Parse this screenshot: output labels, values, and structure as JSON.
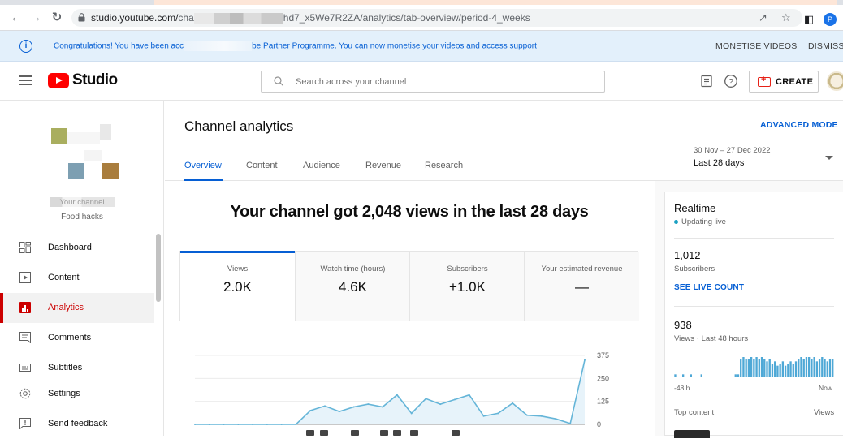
{
  "browser": {
    "url_prefix": "studio.youtube.com/",
    "url_partial": "cha",
    "url_suffix": "hd7_x5We7R2ZA/analytics/tab-overview/period-4_weeks",
    "profile_initial": "P"
  },
  "banner": {
    "message_start": "Congratulations! You have been acc",
    "message_end": "be Partner Programme. You can now monetise your videos and access support",
    "monetise_label": "MONETISE VIDEOS",
    "dismiss_label": "DISMISS"
  },
  "header": {
    "logo_text": "Studio",
    "search_placeholder": "Search across your channel",
    "create_label": "CREATE"
  },
  "sidebar": {
    "channel_name": "Your channel",
    "channel_sub": "Food hacks",
    "items": [
      {
        "label": "Dashboard",
        "icon": "dashboard-icon"
      },
      {
        "label": "Content",
        "icon": "content-icon"
      },
      {
        "label": "Analytics",
        "icon": "analytics-icon",
        "active": true
      },
      {
        "label": "Comments",
        "icon": "comments-icon"
      },
      {
        "label": "Subtitles",
        "icon": "subtitles-icon"
      },
      {
        "label": "Settings",
        "icon": "settings-icon"
      },
      {
        "label": "Send feedback",
        "icon": "feedback-icon"
      }
    ]
  },
  "main": {
    "title": "Channel analytics",
    "advanced_mode": "ADVANCED MODE",
    "tabs": [
      "Overview",
      "Content",
      "Audience",
      "Revenue",
      "Research"
    ],
    "period_range": "30 Nov – 27 Dec 2022",
    "period_label": "Last 28 days",
    "headline": "Your channel got 2,048 views in the last 28 days",
    "cards": [
      {
        "label": "Views",
        "value": "2.0K"
      },
      {
        "label": "Watch time (hours)",
        "value": "4.6K"
      },
      {
        "label": "Subscribers",
        "value": "+1.0K"
      },
      {
        "label": "Your estimated revenue",
        "value": "—"
      }
    ]
  },
  "chart_data": {
    "type": "line",
    "title": "",
    "xlabel": "",
    "ylabel": "",
    "ylim": [
      0,
      375
    ],
    "yticks": [
      0,
      125,
      250,
      375
    ],
    "x": [
      1,
      2,
      3,
      4,
      5,
      6,
      7,
      8,
      9,
      10,
      11,
      12,
      13,
      14,
      15,
      16,
      17,
      18,
      19,
      20,
      21,
      22,
      23,
      24,
      25,
      26,
      27,
      28
    ],
    "values": [
      0,
      0,
      0,
      0,
      0,
      0,
      0,
      0,
      75,
      100,
      70,
      95,
      110,
      95,
      160,
      60,
      140,
      110,
      135,
      160,
      45,
      60,
      115,
      50,
      45,
      30,
      5,
      350
    ],
    "series_color": "#65b5d8"
  },
  "realtime": {
    "title": "Realtime",
    "status": "Updating live",
    "subs_value": "1,012",
    "subs_label": "Subscribers",
    "live_count_link": "SEE LIVE COUNT",
    "views_value": "938",
    "views_label": "Views · Last 48 hours",
    "axis_start": "-48 h",
    "axis_end": "Now",
    "top_content": "Top content",
    "views_col": "Views",
    "bars": [
      1,
      0,
      0,
      1,
      0,
      0,
      1,
      0,
      0,
      0,
      1,
      0,
      0,
      0,
      0,
      0,
      0,
      0,
      0,
      0,
      0,
      0,
      0,
      1,
      1,
      8,
      9,
      8,
      8,
      9,
      8,
      9,
      8,
      9,
      8,
      7,
      8,
      6,
      7,
      5,
      6,
      7,
      5,
      6,
      7,
      6,
      7,
      8,
      9,
      8,
      9,
      9,
      8,
      9,
      7,
      8,
      9,
      8,
      7,
      8,
      8
    ]
  }
}
